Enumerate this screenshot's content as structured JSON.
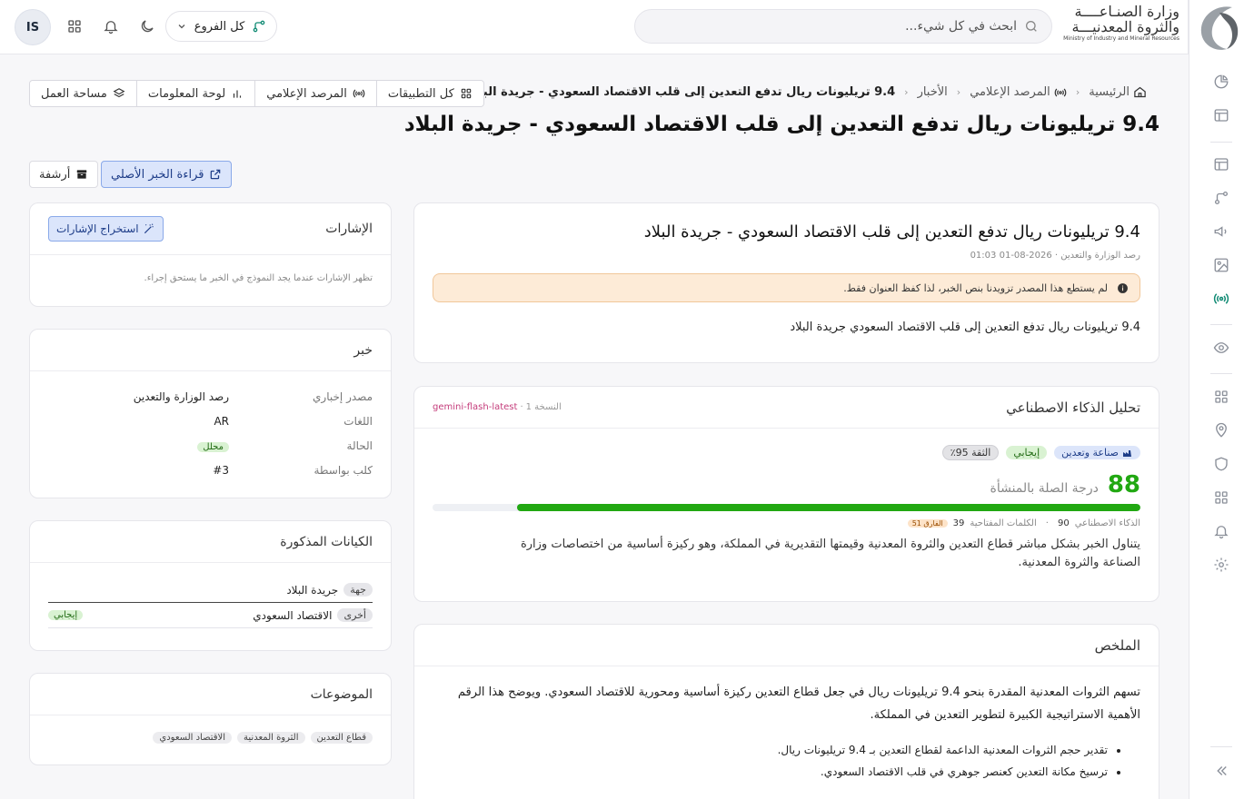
{
  "brand": {
    "line1": "وزارة الصنـاعــــة",
    "line2": "والثروة المعدنيـــة",
    "line3": "Ministry of Industry and Mineral Resources"
  },
  "header": {
    "search_placeholder": "ابحث في كل شيء...",
    "branches_label": "كل الفروع",
    "avatar_initials": "IS"
  },
  "breadcrumb": [
    "الرئيسية",
    "المرصد الإعلامي",
    "الأخبار",
    "9.4 تريليونات ريال تدفع التعدين إلى قلب الاقتصاد السعودي - جريدة البلاد"
  ],
  "app_tabs": [
    "كل التطبيقات",
    "المرصد الإعلامي",
    "لوحة المعلومات",
    "مساحة العمل"
  ],
  "page": {
    "title": "9.4 تريليونات ريال تدفع التعدين إلى قلب الاقتصاد السعودي - جريدة البلاد",
    "read_original": "قراءة الخبر الأصلي",
    "archive": "أرشفة"
  },
  "article": {
    "title": "9.4 تريليونات ريال تدفع التعدين إلى قلب الاقتصاد السعودي - جريدة البلاد",
    "meta": "رصد الوزارة والتعدين · 2026-08-01 01:03",
    "notice": "لم يستطع هذا المصدر تزويدنا بنص الخبر، لذا كفظ العنوان فقط.",
    "body": "9.4 تريليونات ريال تدفع التعدين إلى قلب الاقتصاد السعودي جريدة البلاد"
  },
  "ai": {
    "title": "تحليل الذكاء الاصطناعي",
    "version": "النسخة 1",
    "model": "gemini-flash-latest",
    "category": "صناعة وتعدين",
    "sentiment": "إيجابي",
    "confidence": "الثقة 95٪",
    "relevance_score": "88",
    "relevance_label": "درجة الصلة بالمنشأة",
    "relevance_fraction": 0.88,
    "ai_label": "الذكاء الاصطناعي",
    "ai_value": "90",
    "kw_label": "الكلمات المفتاحية",
    "kw_value": "39",
    "diff": "الفارق 51",
    "rationale": "يتناول الخبر بشكل مباشر قطاع التعدين والثروة المعدنية وقيمتها التقديرية في المملكة، وهو ركيزة أساسية من اختصاصات وزارة الصناعة والثروة المعدنية."
  },
  "summary": {
    "title": "الملخص",
    "text": "تسهم الثروات المعدنية المقدرة بنحو 9.4 تريليونات ريال في جعل قطاع التعدين ركيزة أساسية ومحورية للاقتصاد السعودي. ويوضح هذا الرقم الأهمية الاستراتيجية الكبيرة لتطوير التعدين في المملكة.",
    "bullets": [
      "تقدير حجم الثروات المعدنية الداعمة لقطاع التعدين بـ 9.4 تريليونات ريال.",
      "ترسيخ مكانة التعدين كعنصر جوهري في قلب الاقتصاد السعودي."
    ]
  },
  "signals": {
    "title": "الإشارات",
    "button": "استخراج الإشارات",
    "empty": "تظهر الإشارات عندما يجد النموذج في الخبر ما يستحق إجراء."
  },
  "news": {
    "title": "خبر",
    "rows": [
      {
        "k": "مصدر إخباري",
        "v": "رصد الوزارة والتعدين"
      },
      {
        "k": "اللغات",
        "v": "AR"
      },
      {
        "k": "الحالة",
        "v": "محلل"
      },
      {
        "k": "كلب بواسطة",
        "v": "#3"
      }
    ]
  },
  "entities": {
    "title": "الكيانات المذكورة",
    "items": [
      {
        "type": "جهة",
        "name": "جريدة البلاد",
        "sentiment": ""
      },
      {
        "type": "أخرى",
        "name": "الاقتصاد السعودي",
        "sentiment": "إيجابي"
      }
    ]
  },
  "topics": {
    "title": "الموضوعات",
    "items": [
      "قطاع التعدين",
      "الثروة المعدنية",
      "الاقتصاد السعودي"
    ]
  },
  "colors": {
    "accent": "#0f8a73",
    "score_green": "#21a812",
    "link": "#2a4fc6",
    "notice_bg": "#fdebd7",
    "info_blue": "#dbe5fb"
  }
}
